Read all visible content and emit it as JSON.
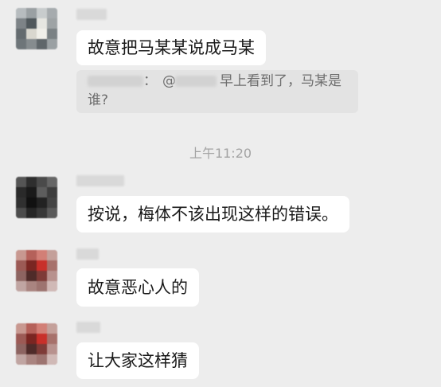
{
  "conversation": {
    "messages": [
      {
        "text": "故意把马某某说成马某"
      },
      {
        "text": "按说，梅体不该出现这样的错误。"
      },
      {
        "text": "故意恶心人的"
      },
      {
        "text": "让大家这样猜"
      }
    ],
    "quote": {
      "separator": "：",
      "mention_at": "@",
      "line1": "早上看到了，马某是",
      "line2": "谁?"
    },
    "timestamp": "上午11:20"
  }
}
